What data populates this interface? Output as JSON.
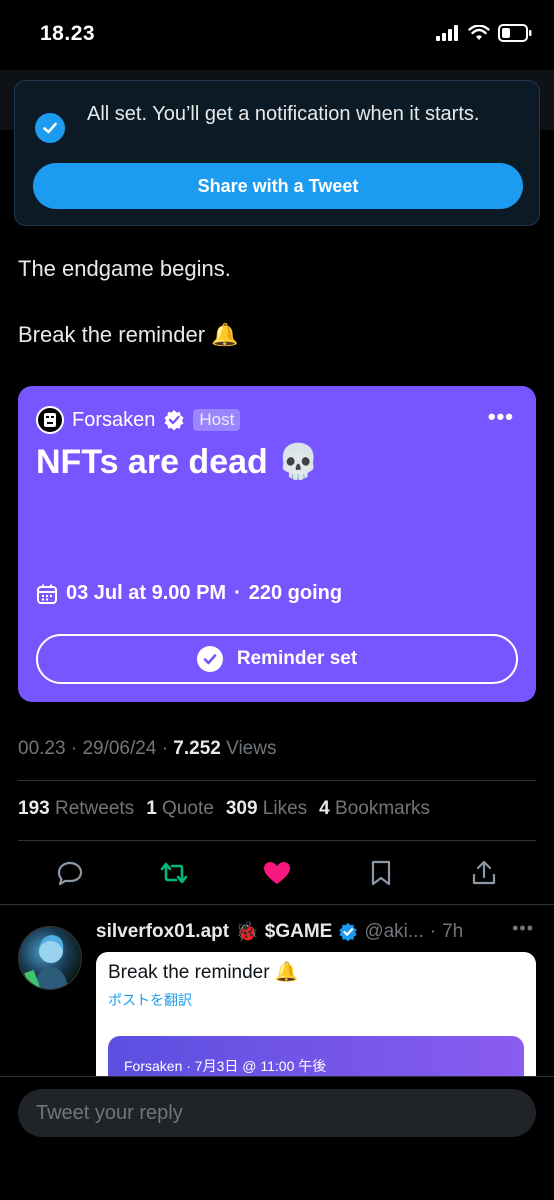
{
  "status": {
    "time": "18.23"
  },
  "toast": {
    "message": "All set. You’ll get a notification when it starts.",
    "share_label": "Share with a Tweet"
  },
  "tweet": {
    "line1": "The endgame begins.",
    "line2": "Break the reminder 🔔"
  },
  "space": {
    "host_name": "Forsaken",
    "host_badge": "Host",
    "more": "•••",
    "title": "NFTs are dead 💀",
    "date": "03 Jul at 9.00 PM",
    "dot": "·",
    "going": "220 going",
    "reminder_label": "Reminder set"
  },
  "meta": {
    "time": "00.23",
    "sep1": "·",
    "date": "29/06/24",
    "sep2": "·",
    "views_count": "7.252",
    "views_label": "Views"
  },
  "stats": {
    "retweets_count": "193",
    "retweets_label": "Retweets",
    "quotes_count": "1",
    "quotes_label": "Quote",
    "likes_count": "309",
    "likes_label": "Likes",
    "bookmarks_count": "4",
    "bookmarks_label": "Bookmarks"
  },
  "reply": {
    "name": "silverfox01.apt",
    "emoji": "🐞",
    "game": "$GAME",
    "handle": "@aki...",
    "dot": "·",
    "time": "7h",
    "more": "•••",
    "text": "Break the reminder 🔔",
    "translate": "ポストを翻訳",
    "embedded_space": "Forsaken · 7月3日 @ 11:00 午後"
  },
  "compose": {
    "placeholder": "Tweet your reply"
  },
  "colors": {
    "accent": "#1d9bf0",
    "space_purple": "#7856ff",
    "like_pink": "#f91880",
    "retweet_green": "#00ba7c"
  }
}
